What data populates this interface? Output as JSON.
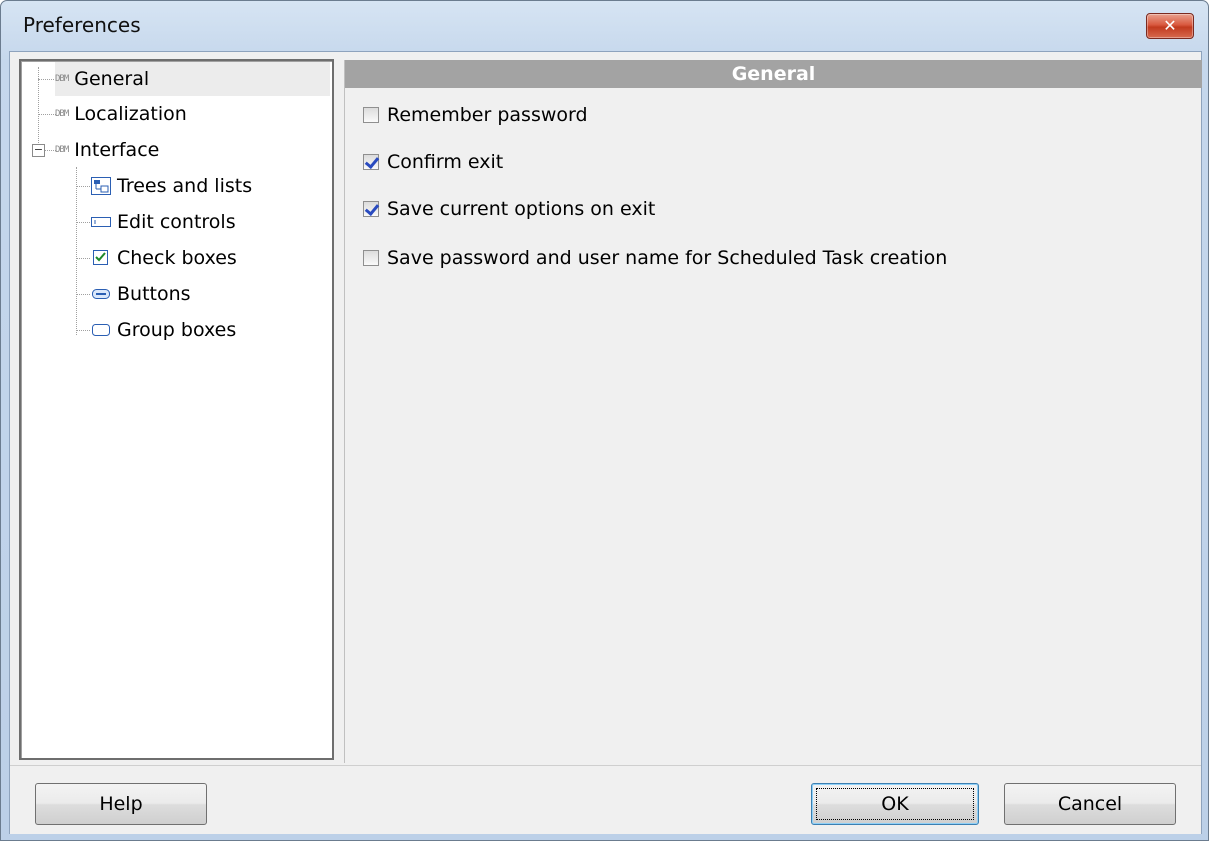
{
  "window": {
    "title": "Preferences",
    "close_glyph": "✕"
  },
  "tree": {
    "items": [
      {
        "label": "General",
        "icon": "db-icon",
        "selected": true
      },
      {
        "label": "Localization",
        "icon": "db-icon"
      },
      {
        "label": "Interface",
        "icon": "db-icon",
        "expanded": true,
        "expander": "−"
      },
      {
        "label": "Trees and lists",
        "icon": "tree-view-icon"
      },
      {
        "label": "Edit controls",
        "icon": "edit-control-icon"
      },
      {
        "label": "Check boxes",
        "icon": "checkbox-icon"
      },
      {
        "label": "Buttons",
        "icon": "button-icon"
      },
      {
        "label": "Group boxes",
        "icon": "group-box-icon"
      }
    ],
    "db_glyph": "DBM"
  },
  "panel": {
    "header": "General",
    "options": [
      {
        "label": "Remember password",
        "checked": false
      },
      {
        "label": "Confirm exit",
        "checked": true
      },
      {
        "label": "Save current options on exit",
        "checked": true
      },
      {
        "label": "Save password and user name for Scheduled Task creation",
        "checked": false
      }
    ]
  },
  "buttons": {
    "help": "Help",
    "ok": "OK",
    "cancel": "Cancel"
  },
  "colors": {
    "header_bg": "#a3a3a3",
    "check_color": "#2a4bbf",
    "close_red": "#c23a1f"
  }
}
